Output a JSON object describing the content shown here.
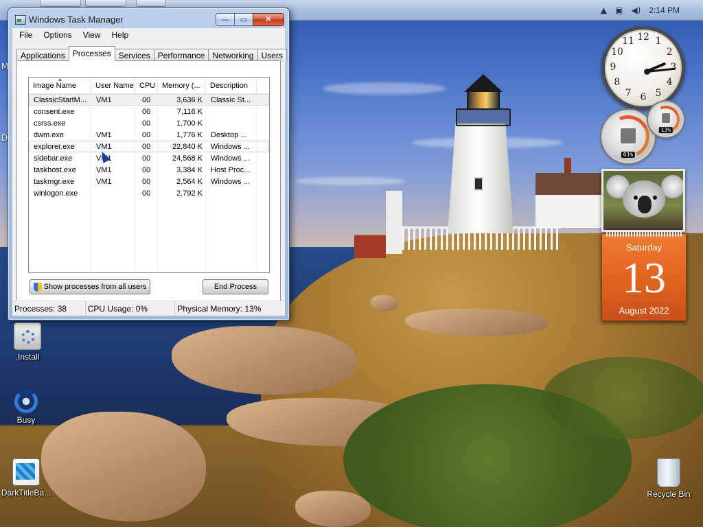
{
  "taskbar": {
    "clock": "2:14 PM",
    "tray_icons": [
      "show-hidden-icons-icon",
      "network-icon",
      "volume-icon"
    ]
  },
  "desktop": {
    "icons": [
      {
        "name": "install",
        "label": ".Install"
      },
      {
        "name": "busy",
        "label": "Busy"
      },
      {
        "name": "darktitlebar",
        "label": "DarkTitleBa..."
      },
      {
        "name": "recycle-bin",
        "label": "Recycle Bin"
      }
    ],
    "partial_letters": [
      "M",
      "D"
    ]
  },
  "gadgets": {
    "clock": {
      "numbers": [
        "12",
        "1",
        "2",
        "3",
        "4",
        "5",
        "6",
        "7",
        "8",
        "9",
        "10",
        "11"
      ],
      "hour": 2,
      "minute": 14
    },
    "cpu_meter": {
      "cpu": "01%",
      "memory": "13%"
    },
    "calendar": {
      "weekday": "Saturday",
      "day": "13",
      "month_year": "August 2022"
    }
  },
  "window": {
    "title": "Windows Task Manager",
    "controls": {
      "minimize": "—",
      "maximize": "▭",
      "close": "✕"
    },
    "menu": [
      "File",
      "Options",
      "View",
      "Help"
    ],
    "tabs": [
      "Applications",
      "Processes",
      "Services",
      "Performance",
      "Networking",
      "Users"
    ],
    "active_tab": "Processes",
    "columns": [
      "Image Name",
      "User Name",
      "CPU",
      "Memory (...",
      "Description"
    ],
    "processes": [
      {
        "image": "ClassicStartM...",
        "user": "VM1",
        "cpu": "00",
        "memory": "3,636 K",
        "desc": "Classic St..."
      },
      {
        "image": "consent.exe",
        "user": "",
        "cpu": "00",
        "memory": "7,116 K",
        "desc": ""
      },
      {
        "image": "csrss.exe",
        "user": "",
        "cpu": "00",
        "memory": "1,700 K",
        "desc": ""
      },
      {
        "image": "dwm.exe",
        "user": "VM1",
        "cpu": "00",
        "memory": "1,776 K",
        "desc": "Desktop ..."
      },
      {
        "image": "explorer.exe",
        "user": "VM1",
        "cpu": "00",
        "memory": "22,840 K",
        "desc": "Windows ..."
      },
      {
        "image": "sidebar.exe",
        "user": "VM1",
        "cpu": "00",
        "memory": "24,568 K",
        "desc": "Windows ..."
      },
      {
        "image": "taskhost.exe",
        "user": "VM1",
        "cpu": "00",
        "memory": "3,384 K",
        "desc": "Host Proc..."
      },
      {
        "image": "taskmgr.exe",
        "user": "VM1",
        "cpu": "00",
        "memory": "2,564 K",
        "desc": "Windows ..."
      },
      {
        "image": "winlogon.exe",
        "user": "",
        "cpu": "00",
        "memory": "2,792 K",
        "desc": ""
      }
    ],
    "show_all_button": "Show processes from all users",
    "end_process_button": "End Process",
    "status": {
      "processes": "Processes: 38",
      "cpu": "CPU Usage: 0%",
      "memory": "Physical Memory: 13%"
    }
  }
}
